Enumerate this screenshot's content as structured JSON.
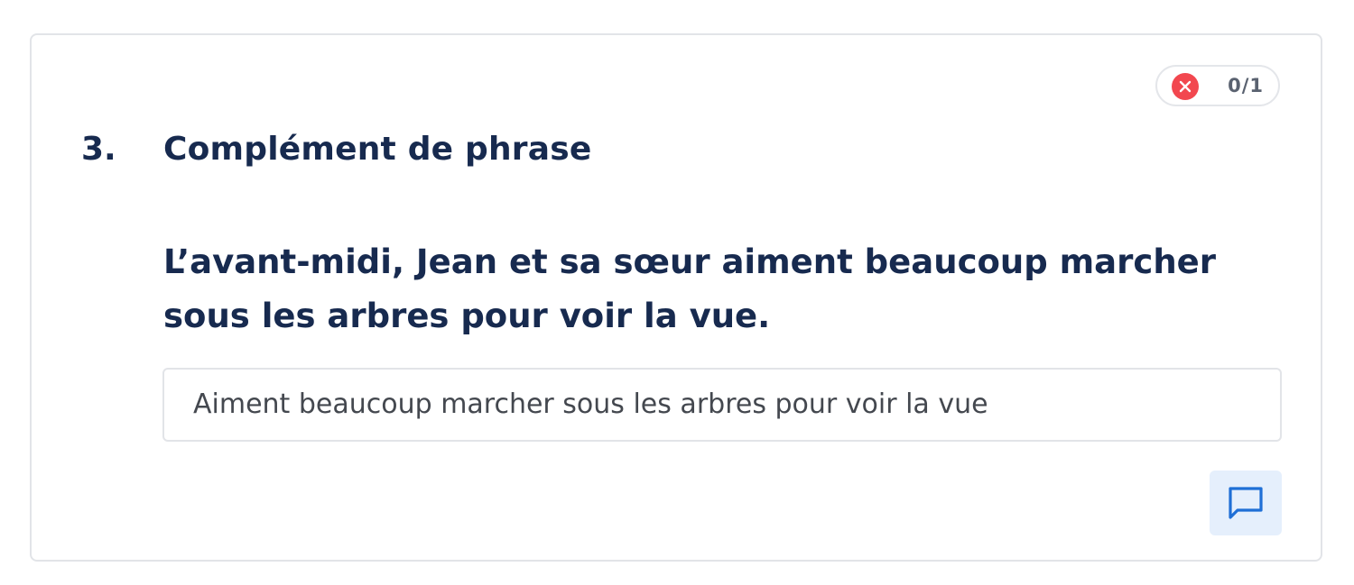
{
  "score": {
    "value": "0/1",
    "status_icon": "close-circle-icon",
    "status_color": "#f2474f"
  },
  "question": {
    "number": "3.",
    "title": "Complément de phrase",
    "prompt": "L’avant-midi, Jean et sa sœur aiment beaucoup marcher sous les arbres pour voir la vue.",
    "answer": "Aiment beaucoup marcher sous les arbres pour voir la vue"
  },
  "actions": {
    "comment_icon": "comment-icon",
    "accent_color": "#1f6fd6"
  }
}
